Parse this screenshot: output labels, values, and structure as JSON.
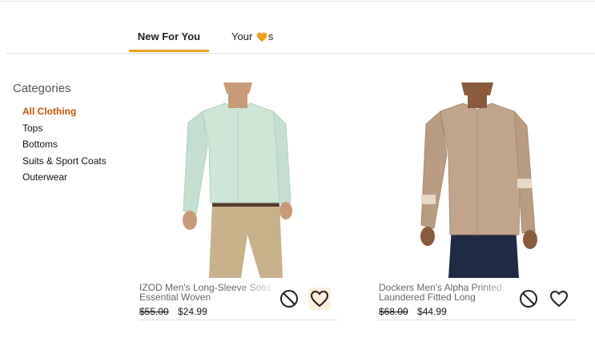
{
  "tabs": {
    "new_for_you": "New For You",
    "your_prefix": "Your",
    "your_suffix": "s"
  },
  "sidebar": {
    "title": "Categories",
    "items": [
      "All Clothing",
      "Tops",
      "Bottoms",
      "Suits & Sport Coats",
      "Outerwear"
    ],
    "active_index": 0
  },
  "products": [
    {
      "title": "IZOD Men's Long-Sleeve Solid Essential Woven",
      "old_price": "$55.00",
      "price": "$24.99",
      "shirt_color": "#cde6d6"
    },
    {
      "title": "Dockers Men's Alpha Printed Laundered Fitted Long",
      "old_price": "$68.00",
      "price": "$44.99",
      "shirt_color": "#c2a48a"
    }
  ],
  "colors": {
    "accent": "#e8a51a",
    "active_category": "#c45500",
    "heart_fill": "#f0a020"
  },
  "icons": {
    "dislike": "block-icon",
    "favorite": "heart-outline-icon",
    "tab_heart": "heart-filled-icon"
  }
}
